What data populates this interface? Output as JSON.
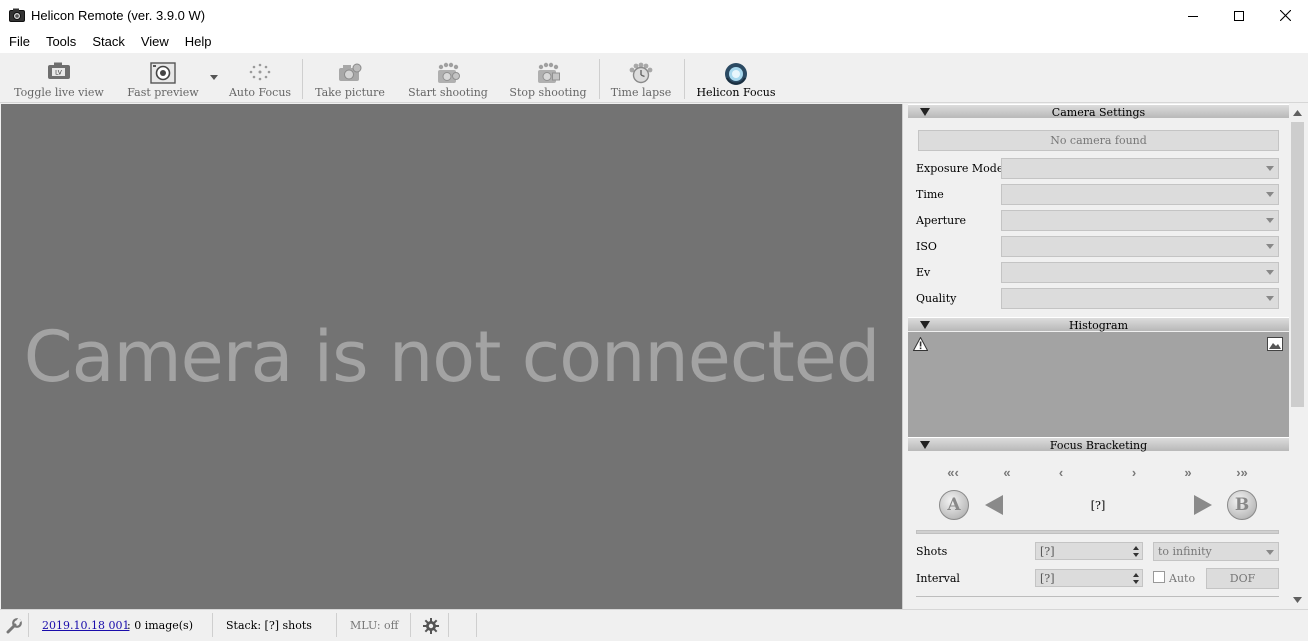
{
  "window": {
    "title": "Helicon Remote (ver. 3.9.0 W)"
  },
  "menu": [
    "File",
    "Tools",
    "Stack",
    "View",
    "Help"
  ],
  "toolbar": {
    "toggle_live_view": "Toggle live view",
    "fast_preview": "Fast preview",
    "auto_focus": "Auto Focus",
    "take_picture": "Take picture",
    "start_shooting": "Start shooting",
    "stop_shooting": "Stop shooting",
    "time_lapse": "Time lapse",
    "helicon_focus": "Helicon Focus"
  },
  "viewport": {
    "message": "Camera is not connected"
  },
  "camera_settings": {
    "title": "Camera Settings",
    "status": "No camera found",
    "properties": [
      "Exposure Mode",
      "Time",
      "Aperture",
      "ISO",
      "Ev",
      "Quality"
    ]
  },
  "histogram": {
    "title": "Histogram"
  },
  "focus_bracketing": {
    "title": "Focus Bracketing",
    "position": "[?]",
    "a_label": "A",
    "b_label": "B",
    "shots_label": "Shots",
    "shots_value": "[?]",
    "shots_mode": "to infinity",
    "interval_label": "Interval",
    "interval_value": "[?]",
    "auto_label": "Auto",
    "dof_label": "DOF"
  },
  "status": {
    "session_link": "2019.10.18 001",
    "images": ": 0 image(s)",
    "stack": "Stack: [?] shots",
    "mlu": "MLU: off"
  },
  "colors": {
    "viewport_bg": "#737373",
    "message_text": "#a3a3a3",
    "link": "#1a0dab"
  }
}
